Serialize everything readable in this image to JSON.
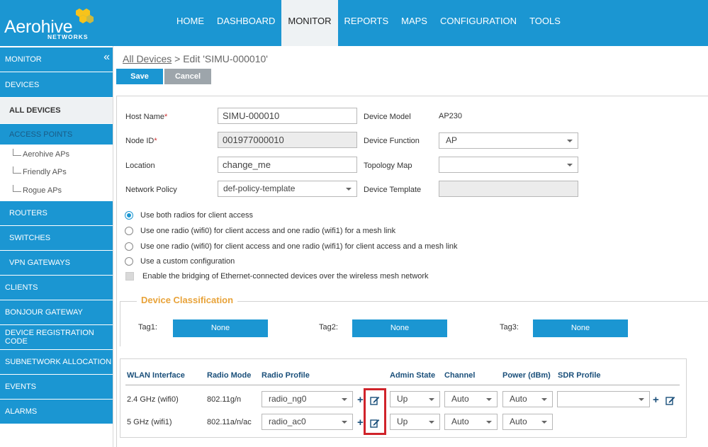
{
  "header": {
    "logo_text": "Aerohive",
    "logo_sub": "NETWORKS",
    "nav": [
      "HOME",
      "DASHBOARD",
      "MONITOR",
      "REPORTS",
      "MAPS",
      "CONFIGURATION",
      "TOOLS"
    ],
    "active_nav": "MONITOR",
    "brand_color": "#1b96d2"
  },
  "sidebar": {
    "monitor": "MONITOR",
    "collapse_glyph": "«",
    "devices": "DEVICES",
    "all_devices": "ALL DEVICES",
    "access_points": "ACCESS POINTS",
    "aerohive_aps": "Aerohive APs",
    "friendly_aps": "Friendly APs",
    "rogue_aps": "Rogue APs",
    "routers": "ROUTERS",
    "switches": "SWITCHES",
    "vpn_gateways": "VPN GATEWAYS",
    "clients": "CLIENTS",
    "bonjour_gateway": "BONJOUR GATEWAY",
    "device_registration_code": "DEVICE REGISTRATION CODE",
    "subnetwork_allocation": "SUBNETWORK ALLOCATION",
    "events": "EVENTS",
    "alarms": "ALARMS"
  },
  "breadcrumb": {
    "link": "All Devices",
    "rest": " > Edit 'SIMU-000010'"
  },
  "buttons": {
    "save": "Save",
    "cancel": "Cancel"
  },
  "form": {
    "host_name_label": "Host Name",
    "host_name_value": "SIMU-000010",
    "node_id_label": "Node ID",
    "node_id_value": "001977000010",
    "location_label": "Location",
    "location_value": "change_me",
    "network_policy_label": "Network Policy",
    "network_policy_value": "def-policy-template",
    "device_model_label": "Device Model",
    "device_model_value": "AP230",
    "device_function_label": "Device Function",
    "device_function_value": "AP",
    "topology_map_label": "Topology Map",
    "topology_map_value": "",
    "device_template_label": "Device Template",
    "device_template_value": "",
    "required_mark": "*"
  },
  "radio_options": [
    "Use both radios for client access",
    "Use one radio (wifi0) for client access and one radio (wifi1) for a mesh link",
    "Use one radio (wifi0) for client access and one radio (wifi1) for client access and a mesh link",
    "Use a custom configuration"
  ],
  "radio_selected_index": 0,
  "bridging_label": "Enable the bridging of Ethernet-connected devices over the wireless mesh network",
  "classification": {
    "title": "Device Classification",
    "tags": [
      {
        "label": "Tag1:",
        "value": "None"
      },
      {
        "label": "Tag2:",
        "value": "None"
      },
      {
        "label": "Tag3:",
        "value": "None"
      }
    ]
  },
  "wlan": {
    "headers": [
      "WLAN Interface",
      "Radio Mode",
      "Radio Profile",
      "Admin State",
      "Channel",
      "Power (dBm)",
      "SDR Profile"
    ],
    "rows": [
      {
        "interface": "2.4 GHz (wifi0)",
        "mode": "802.11g/n",
        "profile": "radio_ng0",
        "admin": "Up",
        "channel": "Auto",
        "power": "Auto",
        "sdr": ""
      },
      {
        "interface": "5 GHz (wifi1)",
        "mode": "802.11a/n/ac",
        "profile": "radio_ac0",
        "admin": "Up",
        "channel": "Auto",
        "power": "Auto"
      }
    ],
    "plus_glyph": "+"
  }
}
